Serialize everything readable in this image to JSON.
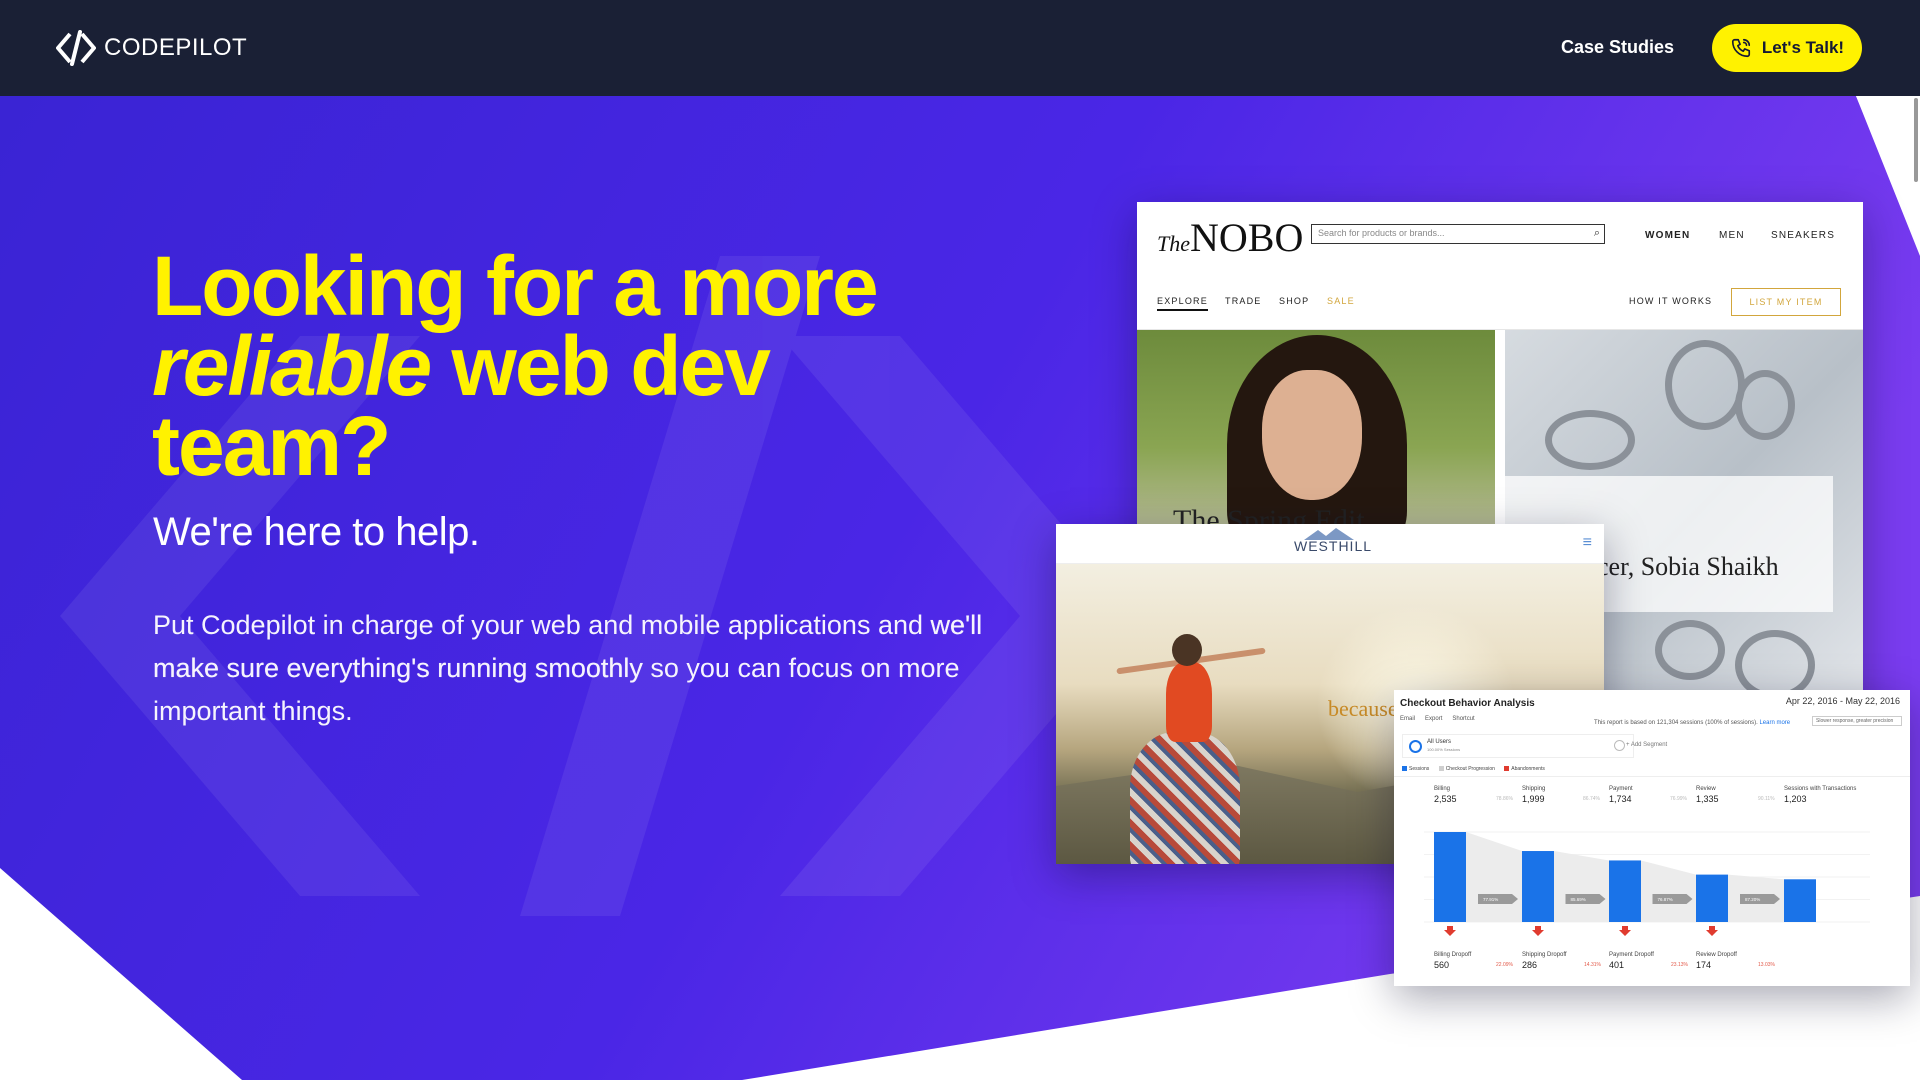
{
  "header": {
    "brand": "CODEPILOT",
    "nav_link": "Case Studies",
    "cta_label": "Let's Talk!"
  },
  "hero": {
    "headline_line1": "Looking for a more",
    "headline_em": "reliable",
    "headline_line2_rest": " web dev",
    "headline_line3": "team?",
    "subhead": "We're here to help.",
    "body_pre": "Put Codepilot in charge of your web and mobile applications and ",
    "body_strong": "we'll make sure everything's running smoothly",
    "body_post": " so you can focus on more important things."
  },
  "nobo_mock": {
    "logo_prefix": "The",
    "logo": "NOBO",
    "search_placeholder": "Search for products or brands...",
    "nav": [
      "WOMEN",
      "MEN",
      "SNEAKERS"
    ],
    "subnav": [
      "EXPLORE",
      "TRADE",
      "SHOP",
      "SALE"
    ],
    "how_it_works": "HOW IT WORKS",
    "list_button": "LIST MY ITEM",
    "caption_left": "The Spring Edit",
    "caption_right": "cer, Sobia Shaikh"
  },
  "westhill_mock": {
    "logo": "WESTHILL",
    "tagline": "because life is best"
  },
  "analytics_mock": {
    "title": "Checkout Behavior Analysis",
    "date_range": "Apr 22, 2016 - May 22, 2016",
    "toolbar": [
      "Email",
      "Export",
      "Shortcut"
    ],
    "note": "This report is based on 121,304 sessions (100% of sessions).",
    "learn_more": "Learn more",
    "sampling": "Slower response, greater precision",
    "segment": "All Users",
    "segment_sub": "100.00% Sessions",
    "add_segment": "+ Add Segment",
    "legend": [
      "Sessions",
      "Checkout Progression",
      "Abandonments"
    ],
    "colors": {
      "sessions": "#1a73e8",
      "abandon": "#e03b2f",
      "progression": "#cfcfcf"
    },
    "stages": [
      {
        "label": "Billing",
        "value": "2,535",
        "pct": ""
      },
      {
        "label": "Shipping",
        "value": "1,999",
        "pct": "78.86%"
      },
      {
        "label": "Payment",
        "value": "1,734",
        "pct": "86.74%"
      },
      {
        "label": "Review",
        "value": "1,335",
        "pct": "76.99%"
      },
      {
        "label": "Sessions with Transactions",
        "value": "1,203",
        "pct": "90.11%"
      }
    ],
    "drops": [
      {
        "label": "Billing Dropoff",
        "value": "560",
        "pct": "22.09%"
      },
      {
        "label": "Shipping Dropoff",
        "value": "286",
        "pct": "14.31%"
      },
      {
        "label": "Payment Dropoff",
        "value": "401",
        "pct": "23.13%"
      },
      {
        "label": "Review Dropoff",
        "value": "174",
        "pct": "13.03%"
      }
    ],
    "progression_badges": [
      "77.91%",
      "85.69%",
      "76.87%",
      "87.20%"
    ]
  }
}
